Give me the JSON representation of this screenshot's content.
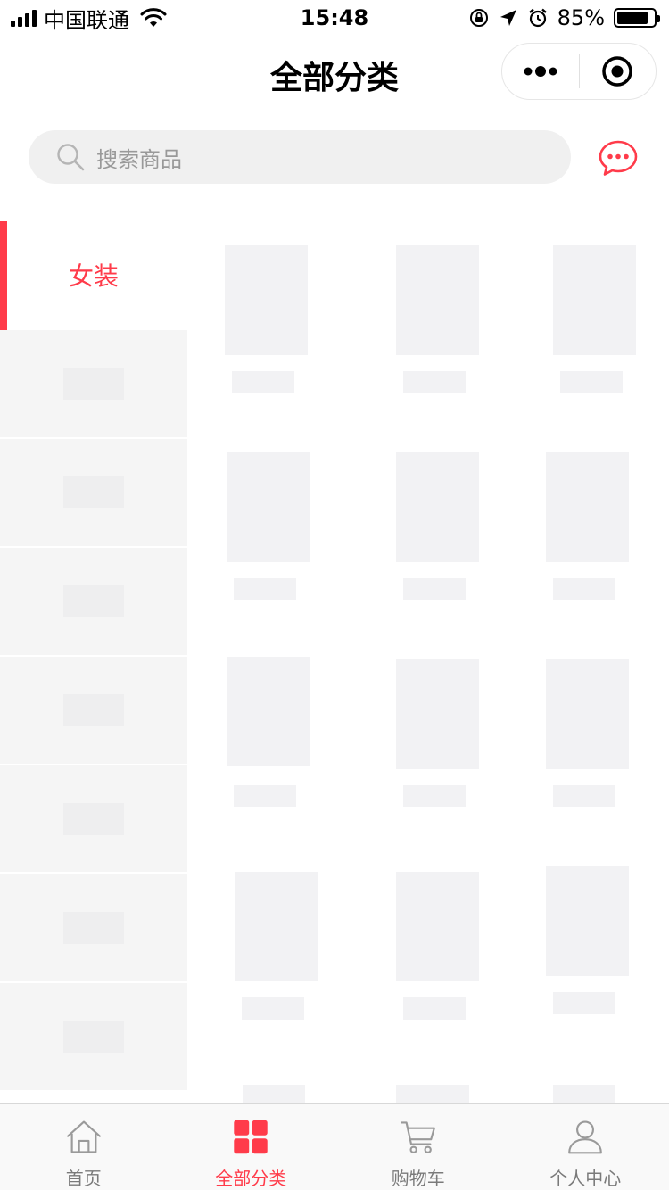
{
  "status_bar": {
    "carrier": "中国联通",
    "time": "15:48",
    "battery_percent": "85%",
    "battery_level": 0.85,
    "icons": [
      "signal-icon",
      "wifi-icon",
      "orientation-lock-icon",
      "location-icon",
      "alarm-icon",
      "battery-icon"
    ]
  },
  "nav": {
    "title": "全部分类",
    "capsule_icons": [
      "more-dots-icon",
      "close-target-icon"
    ]
  },
  "search": {
    "placeholder": "搜索商品",
    "icon": "search-icon",
    "chat_icon": "chat-bubble-icon"
  },
  "sidebar": {
    "items": [
      {
        "label": "女装",
        "active": true
      },
      {
        "label": ""
      },
      {
        "label": ""
      },
      {
        "label": ""
      },
      {
        "label": ""
      },
      {
        "label": ""
      },
      {
        "label": ""
      },
      {
        "label": ""
      }
    ]
  },
  "tab_bar": {
    "tabs": [
      {
        "label": "首页",
        "icon": "home-icon",
        "active": false
      },
      {
        "label": "全部分类",
        "icon": "category-grid-icon",
        "active": true
      },
      {
        "label": "购物车",
        "icon": "cart-icon",
        "active": false
      },
      {
        "label": "个人中心",
        "icon": "user-icon",
        "active": false
      }
    ]
  },
  "colors": {
    "accent": "#ff3b4a",
    "sidebar_bg": "#f5f5f5",
    "skeleton": "#f2f2f4",
    "tab_inactive": "#7a7a7a"
  }
}
